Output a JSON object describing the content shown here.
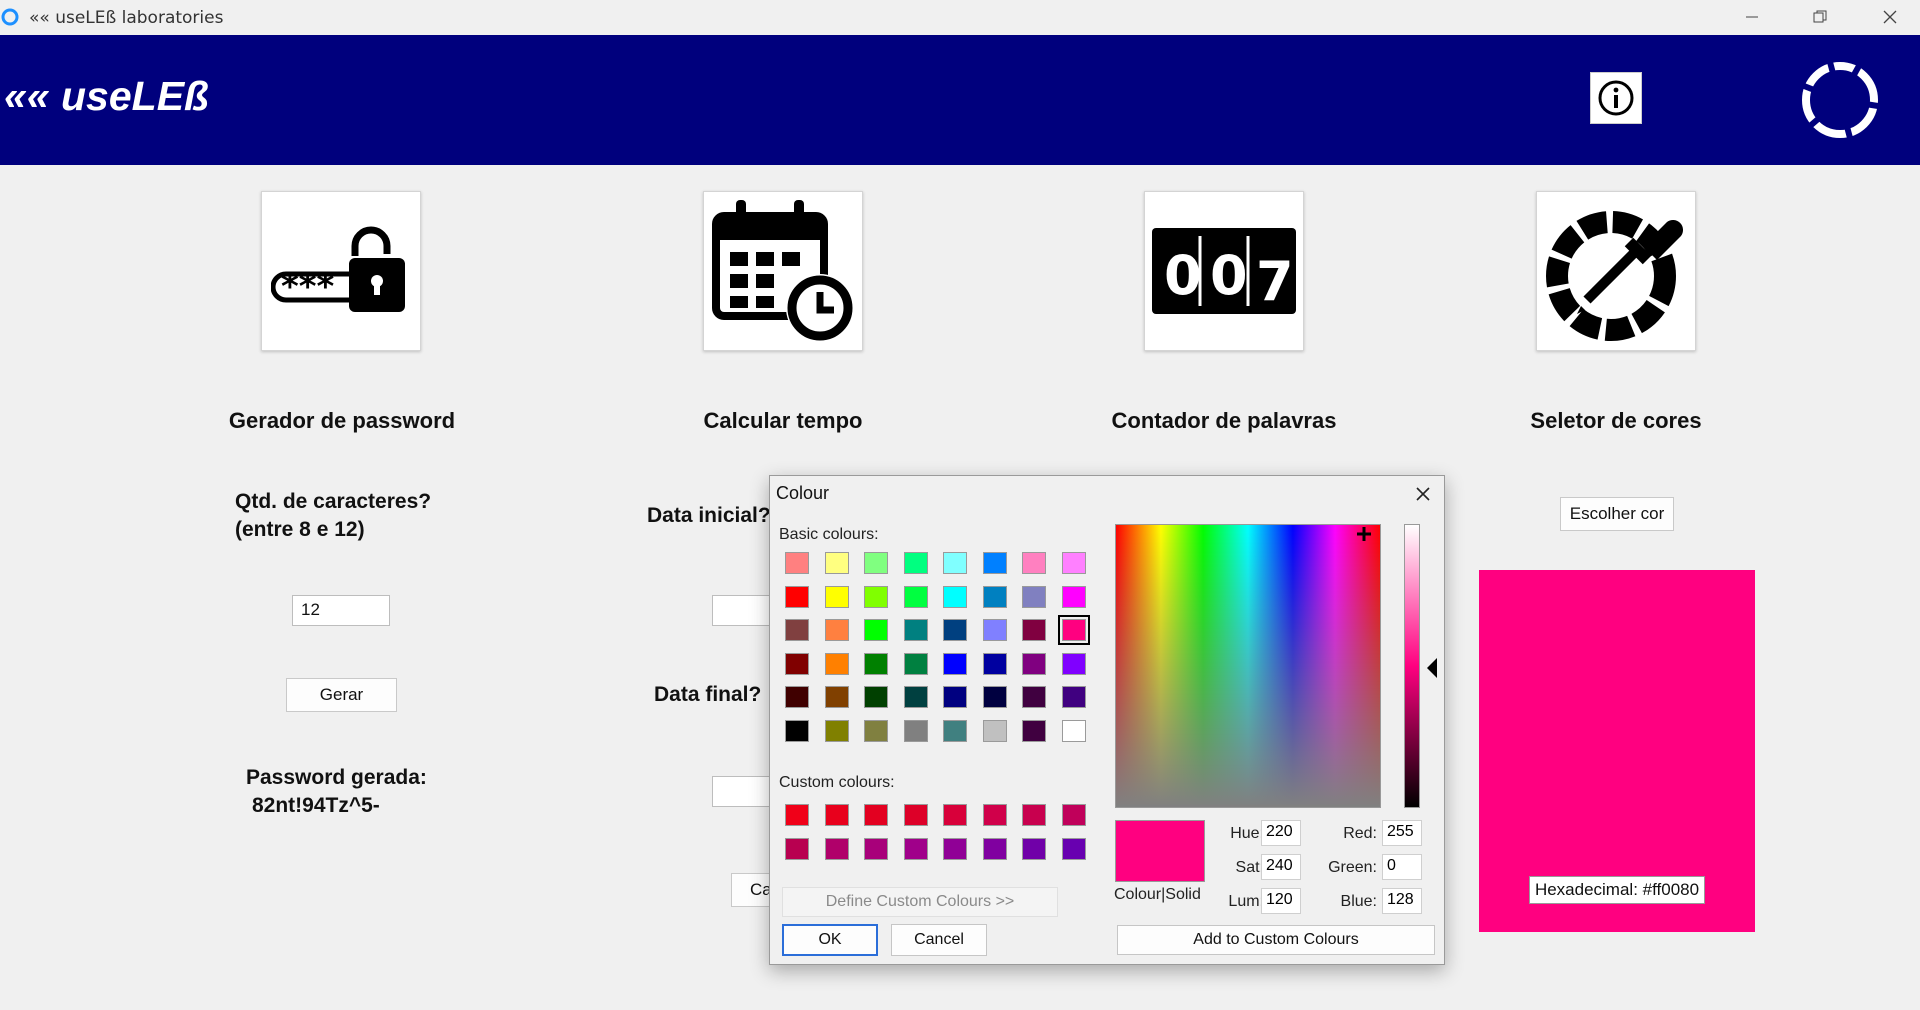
{
  "window": {
    "title": "«« useLEß laboratories"
  },
  "header": {
    "brand": "«« useLEß"
  },
  "tools": {
    "password": {
      "heading": "Gerador de password",
      "qty_label_1": "Qtd. de caracteres?",
      "qty_label_2": "(entre 8 e 12)",
      "qty_value": "12",
      "generate_label": "Gerar",
      "result_label": "Password gerada:",
      "result_value": "82nt!94Tz^5-",
      "mask_text": "***"
    },
    "time": {
      "heading": "Calcular tempo",
      "start_label": "Data inicial?",
      "end_label": "Data final?",
      "calc_label_partial": "Ca"
    },
    "words": {
      "heading": "Contador de palavras",
      "counter_digits": [
        "0",
        "0",
        "7"
      ]
    },
    "colors": {
      "heading": "Seletor de cores",
      "choose_label": "Escolher cor",
      "hex_text": "Hexadecimal: #ff0080",
      "preview_color": "#ff0080"
    }
  },
  "dialog": {
    "title": "Colour",
    "basic_label": "Basic colours:",
    "custom_label": "Custom colours:",
    "define_label": "Define Custom Colours >>",
    "ok_label": "OK",
    "cancel_label": "Cancel",
    "add_label": "Add to Custom Colours",
    "colour_solid_label": "Colour|Solid",
    "hue_label": "Hue:",
    "hue": "220",
    "sat_label": "Sat:",
    "sat": "240",
    "lum_label": "Lum:",
    "lum": "120",
    "red_label": "Red:",
    "red": "255",
    "green_label": "Green:",
    "green": "0",
    "blue_label": "Blue:",
    "blue": "128",
    "selected_color": "#ff0080",
    "basic_colors": [
      [
        "#ff8080",
        "#ffff80",
        "#80ff80",
        "#00ff80",
        "#80ffff",
        "#0080ff",
        "#ff80c0",
        "#ff80ff"
      ],
      [
        "#ff0000",
        "#ffff00",
        "#80ff00",
        "#00ff40",
        "#00ffff",
        "#0080c0",
        "#8080c0",
        "#ff00ff"
      ],
      [
        "#804040",
        "#ff8040",
        "#00ff00",
        "#008080",
        "#004080",
        "#8080ff",
        "#800040",
        "#ff0080"
      ],
      [
        "#800000",
        "#ff8000",
        "#008000",
        "#008040",
        "#0000ff",
        "#0000a0",
        "#800080",
        "#8000ff"
      ],
      [
        "#400000",
        "#804000",
        "#004000",
        "#004040",
        "#000080",
        "#000040",
        "#400040",
        "#400080"
      ],
      [
        "#000000",
        "#808000",
        "#808040",
        "#808080",
        "#408080",
        "#c0c0c0",
        "#400040",
        "#ffffff"
      ]
    ],
    "custom_colors": [
      [
        "#f00018",
        "#e8001c",
        "#e30020",
        "#dd0028",
        "#d8003a",
        "#d0004a",
        "#c8004e",
        "#c0005a"
      ],
      [
        "#b80050",
        "#b0006a",
        "#a8007a",
        "#a0008a",
        "#900096",
        "#8000a0",
        "#7000a8",
        "#6800b0"
      ]
    ]
  }
}
